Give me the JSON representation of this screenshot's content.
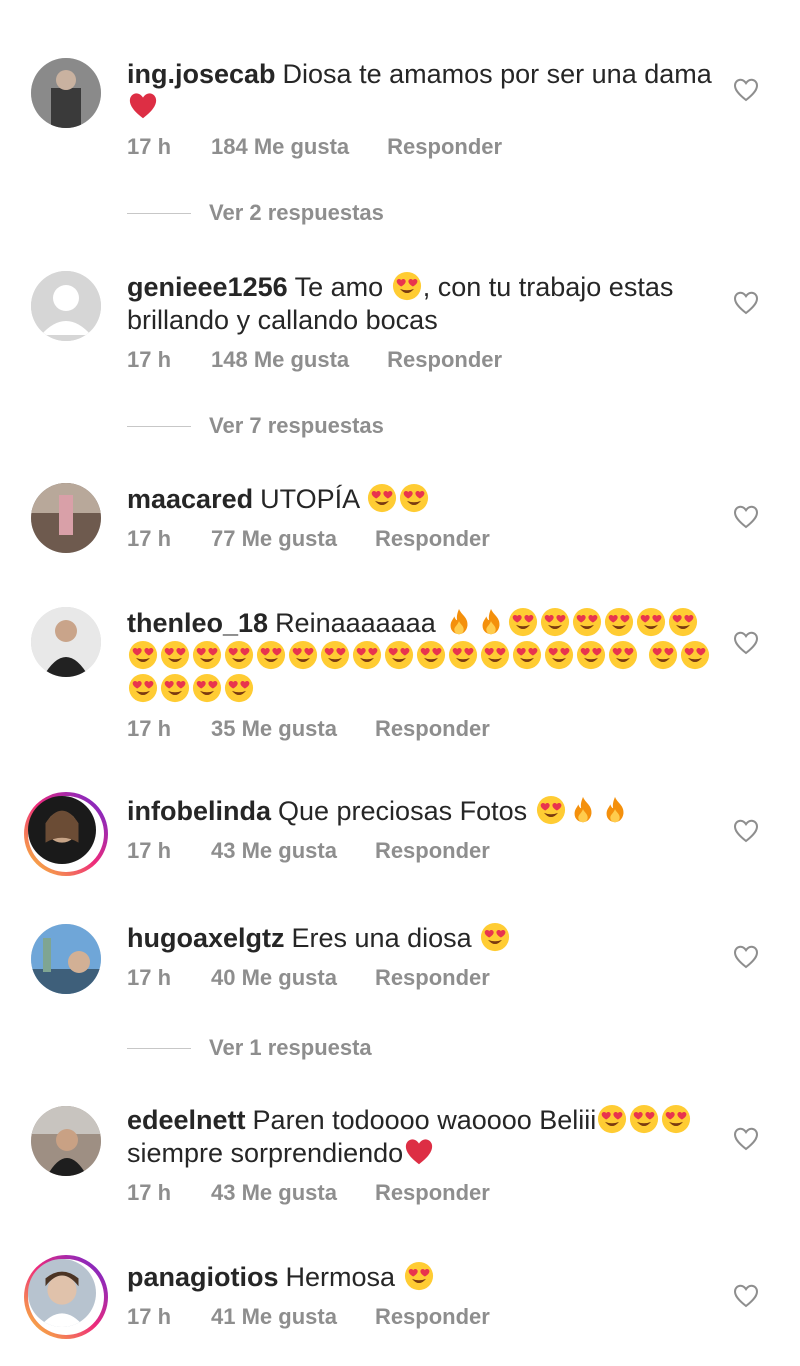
{
  "comments": [
    {
      "username": "ing.josecab",
      "text": "Diosa te amamos por ser una dama",
      "trailing": "heart",
      "time": "17 h",
      "likes": "184 Me gusta",
      "reply": "Responder",
      "replies": "Ver 2 respuestas"
    },
    {
      "username": "genieee1256",
      "text": "Te amo",
      "after": ", con tu trabajo estas brillando y callando bocas",
      "time": "17 h",
      "likes": "148 Me gusta",
      "reply": "Responder",
      "replies": "Ver 7 respuestas"
    },
    {
      "username": "maacared",
      "text": "UTOPÍA",
      "time": "17 h",
      "likes": "77 Me gusta",
      "reply": "Responder"
    },
    {
      "username": "thenleo_18",
      "text": "Reinaaaaaaa",
      "time": "17 h",
      "likes": "35 Me gusta",
      "reply": "Responder"
    },
    {
      "username": "infobelinda",
      "text": "Que preciosas Fotos",
      "time": "17 h",
      "likes": "43 Me gusta",
      "reply": "Responder"
    },
    {
      "username": "hugoaxelgtz",
      "text": "Eres una diosa",
      "time": "17 h",
      "likes": "40 Me gusta",
      "reply": "Responder",
      "replies": "Ver 1 respuesta"
    },
    {
      "username": "edeelnett",
      "text": "Paren todoooo waoooo Beliii",
      "after": "siempre sorprendiendo",
      "time": "17 h",
      "likes": "43 Me gusta",
      "reply": "Responder"
    },
    {
      "username": "panagiotios",
      "text": "Hermosa",
      "time": "17 h",
      "likes": "41 Me gusta",
      "reply": "Responder"
    }
  ],
  "icons": {
    "like": "heart-outline-icon",
    "love_eyes": "heart-eyes-emoji",
    "fire": "fire-emoji",
    "red_heart": "red-heart-emoji"
  }
}
